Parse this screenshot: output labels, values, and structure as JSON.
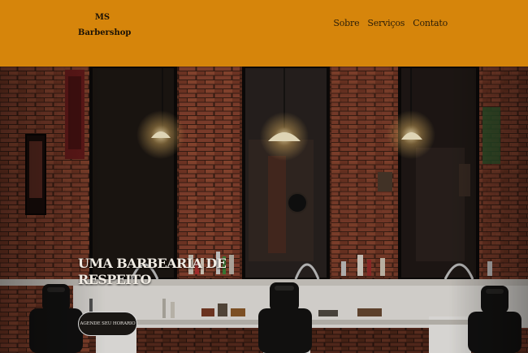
{
  "brand": {
    "line1": "MS",
    "line2": "Barbershop"
  },
  "nav": {
    "items": [
      "Sobre",
      "Serviços",
      "Contato"
    ]
  },
  "hero": {
    "title": "UMA BARBEARIA DE RESPEITO",
    "cta_label": "AGENDE SEU HORARIO"
  },
  "colors": {
    "header": "#d6850b",
    "header_text": "#2a1d08",
    "hero_text": "#f1ece4"
  }
}
